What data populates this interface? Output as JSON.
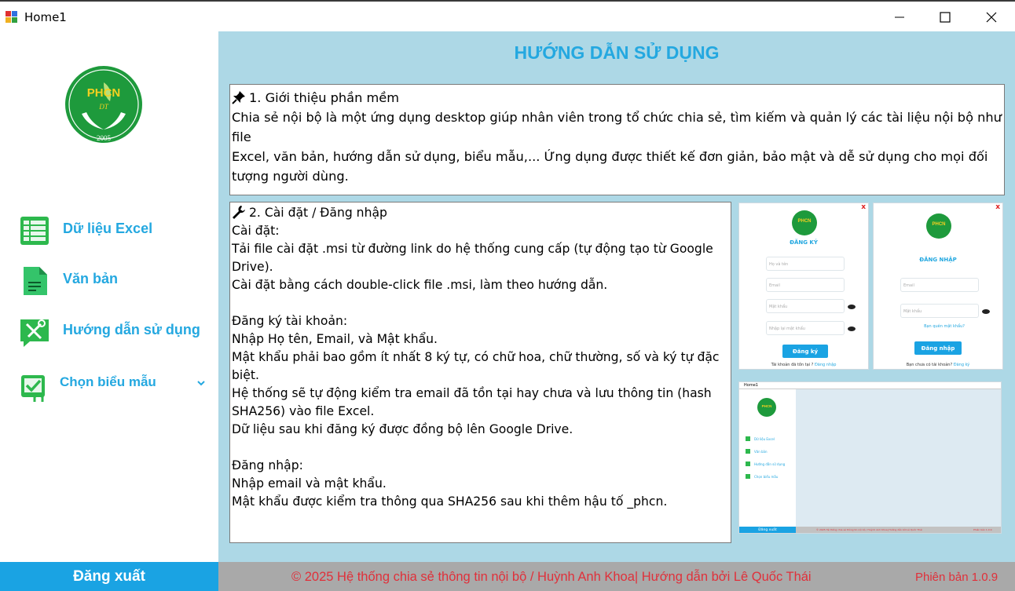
{
  "window": {
    "title": "Home1"
  },
  "sidebar": {
    "logo_text": "PHCN",
    "logo_sub": "DT",
    "logo_year": "2005",
    "items": [
      {
        "label": "Dữ liệu Excel",
        "icon": "excel-grid-icon"
      },
      {
        "label": "Văn bản",
        "icon": "document-icon"
      },
      {
        "label": "Hướng dẫn sử dụng",
        "icon": "tools-icon"
      },
      {
        "label": "Chọn biểu mẫu",
        "icon": "form-check-icon",
        "has_dropdown": true
      }
    ],
    "logout_label": "Đăng xuất"
  },
  "main": {
    "title": "HƯỚNG DẪN SỬ DỤNG",
    "section1": {
      "heading": "1. Giới thiệu phần mềm",
      "lines": [
        "Chia sẻ nội bộ là một ứng dụng desktop giúp nhân viên trong tổ chức chia sẻ, tìm kiếm và quản lý các tài liệu nội bộ như file",
        "Excel, văn bản, hướng dẫn sử dụng, biểu mẫu,... Ứng dụng được thiết kế đơn giản, bảo mật và dễ sử dụng cho mọi đối",
        "tượng người dùng."
      ]
    },
    "section2": {
      "heading": "2. Cài đặt / Đăng nhập",
      "lines": [
        "Cài đặt:",
        "Tải file cài đặt .msi từ đường link do hệ thống cung cấp (tự động tạo từ Google",
        "Drive).",
        "Cài đặt bằng cách double-click file .msi, làm theo hướng dẫn.",
        "",
        "Đăng ký tài khoản:",
        "Nhập Họ tên, Email, và Mật khẩu.",
        "Mật khẩu phải bao gồm ít nhất 8 ký tự, có chữ hoa, chữ thường, số và ký tự đặc",
        "biệt.",
        "Hệ thống sẽ tự động kiểm tra email đã tồn tại hay chưa và lưu thông tin (hash",
        "SHA256) vào file Excel.",
        "Dữ liệu sau khi đăng ký được đồng bộ lên Google Drive.",
        "",
        "Đăng nhập:",
        "Nhập email và mật khẩu.",
        "Mật khẩu được kiểm tra thông qua SHA256 sau khi thêm hậu tố _phcn."
      ]
    },
    "previews": {
      "register": {
        "title": "ĐĂNG KÝ",
        "fields": [
          "Họ và tên",
          "Email",
          "Mật khẩu",
          "Nhập lại mật khẩu"
        ],
        "button": "Đăng ký",
        "footer": "Tài khoản đã tồn tại ?",
        "footer_link": "Đăng nhập"
      },
      "login": {
        "title": "ĐĂNG NHẬP",
        "fields": [
          "Email",
          "Mật khẩu"
        ],
        "forgot": "Bạn quên mật khẩu?",
        "button": "Đăng nhập",
        "footer": "Bạn chưa có tài khoản?",
        "footer_link": "Đăng ký"
      },
      "home": {
        "title": "Home1",
        "items": [
          "Dữ liệu Excel",
          "Văn bản",
          "Hướng dẫn sử dụng",
          "Chọn biểu mẫu"
        ],
        "logout": "Đăng xuất",
        "footer": "© 2025  Hệ thống chia sẻ thông tin nội bộ / Huỳnh Anh Khoa| Hướng dẫn bởi Lê Quốc Thái",
        "version": "Phiên bản 1.0.9"
      }
    }
  },
  "footer": {
    "text": "© 2025  Hệ thống chia sẻ thông tin nội bộ / Huỳnh Anh Khoa| Hướng dẫn bởi Lê Quốc Thái",
    "version": "Phiên bản 1.0.9"
  },
  "colors": {
    "accent": "#24a8e0",
    "main_bg": "#add8e6",
    "footer_bg": "#a9a9a9",
    "footer_text": "#e0303a",
    "logo_green": "#1e9a3c"
  }
}
